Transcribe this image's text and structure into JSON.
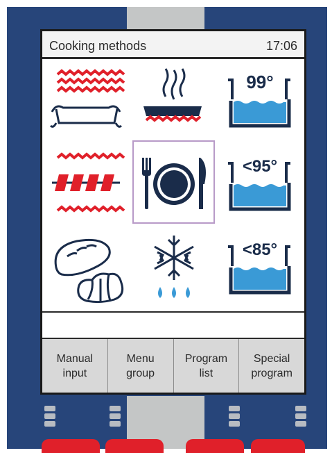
{
  "header": {
    "title": "Cooking methods",
    "time": "17:06"
  },
  "methods": [
    {
      "id": "grill",
      "icon": "grill-icon"
    },
    {
      "id": "pan-fry",
      "icon": "pan-fry-icon"
    },
    {
      "id": "boil",
      "icon": "water-bath-icon",
      "temp": "99°"
    },
    {
      "id": "skewer",
      "icon": "skewer-icon"
    },
    {
      "id": "finishing",
      "icon": "plate-cutlery-icon",
      "selected": true
    },
    {
      "id": "poach",
      "icon": "water-bath-icon",
      "temp": "<95°"
    },
    {
      "id": "bake",
      "icon": "bread-croissant-icon"
    },
    {
      "id": "defrost",
      "icon": "snowflake-drops-icon"
    },
    {
      "id": "low-temp",
      "icon": "water-bath-icon",
      "temp": "<85°"
    }
  ],
  "softkeys": [
    {
      "label": "Manual\ninput"
    },
    {
      "label": "Menu\ngroup"
    },
    {
      "label": "Program\nlist"
    },
    {
      "label": "Special\nprogram"
    }
  ],
  "colors": {
    "bezel": "#27457a",
    "heat": "#e0202a",
    "water": "#3a9ad6",
    "icon": "#1a2c4a",
    "selection": "#b89ac8"
  }
}
